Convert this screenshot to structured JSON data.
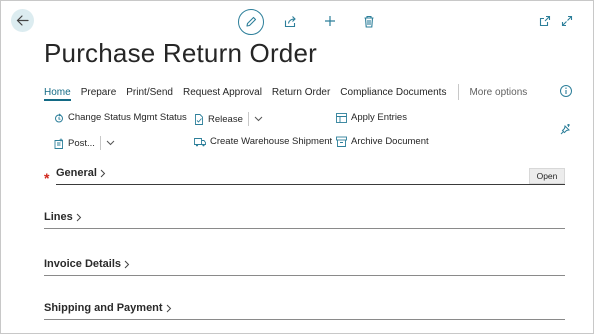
{
  "page": {
    "title": "Purchase Return Order"
  },
  "toolbar_icons": [
    "back-arrow-icon",
    "edit-pencil-icon",
    "share-icon",
    "plus-icon",
    "trash-icon",
    "open-new-window-icon",
    "expand-icon"
  ],
  "action_bar": {
    "tabs": [
      "Home",
      "Prepare",
      "Print/Send",
      "Request Approval",
      "Return Order",
      "Compliance Documents"
    ],
    "more_options": "More options"
  },
  "commands": {
    "change_status": "Change Status Mgmt Status",
    "release": "Release",
    "apply_entries": "Apply Entries",
    "post": "Post...",
    "create_shipment": "Create Warehouse Shipment",
    "archive": "Archive Document"
  },
  "sections": {
    "general": "General",
    "lines": "Lines",
    "invoice_details": "Invoice Details",
    "shipping_payment": "Shipping and Payment",
    "required_marker": "*",
    "open_button": "Open"
  },
  "colors": {
    "accent": "#136a85",
    "required": "#d1271c",
    "back_button_bg": "#dcecf0"
  }
}
